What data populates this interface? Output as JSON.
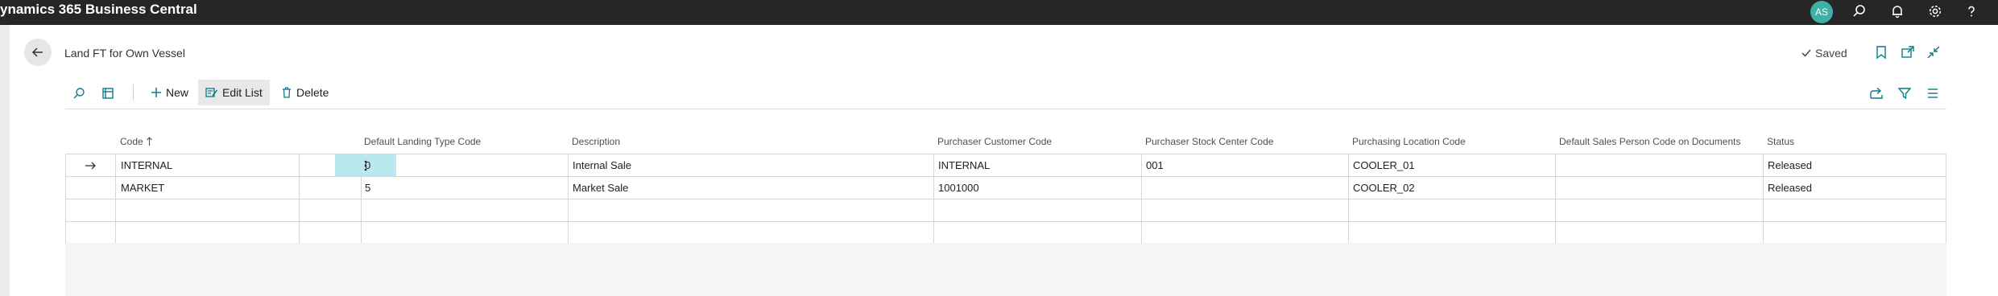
{
  "app": {
    "title": "ynamics 365 Business Central",
    "avatar_initials": "AS"
  },
  "page": {
    "title": "Land FT for Own Vessel",
    "saved_label": "Saved"
  },
  "actions": {
    "new_label": "New",
    "edit_list_label": "Edit List",
    "delete_label": "Delete"
  },
  "columns": {
    "code": "Code",
    "default_landing_type_code": "Default Landing Type Code",
    "description": "Description",
    "purchaser_customer_code": "Purchaser Customer Code",
    "purchaser_stock_center_code": "Purchaser Stock Center Code",
    "purchasing_location_code": "Purchasing Location Code",
    "default_sales_person_code": "Default Sales Person Code on Documents",
    "status": "Status"
  },
  "rows": [
    {
      "code": "INTERNAL",
      "landing_type": "0",
      "description": "Internal Sale",
      "customer": "INTERNAL",
      "stock_center": "001",
      "location": "COOLER_01",
      "sales_person": "",
      "status": "Released"
    },
    {
      "code": "MARKET",
      "landing_type": "5",
      "description": "Market Sale",
      "customer": "1001000",
      "stock_center": "",
      "location": "COOLER_02",
      "sales_person": "",
      "status": "Released"
    }
  ],
  "colors": {
    "topbar": "#262626",
    "accent": "#00a4b4",
    "selected_cell": "#b9e8ef",
    "avatar": "#3fb0a5"
  },
  "icons": [
    "back-arrow-icon",
    "search-icon",
    "bell-icon",
    "settings-gear-icon",
    "help-icon",
    "bookmark-icon",
    "open-new-window-icon",
    "collapse-icon",
    "checkmark-icon",
    "plus-icon",
    "edit-list-icon",
    "trash-icon",
    "share-icon",
    "filter-icon",
    "list-view-icon",
    "tablet-view-icon",
    "sort-ascending-icon",
    "row-arrow-icon",
    "more-options-icon"
  ]
}
